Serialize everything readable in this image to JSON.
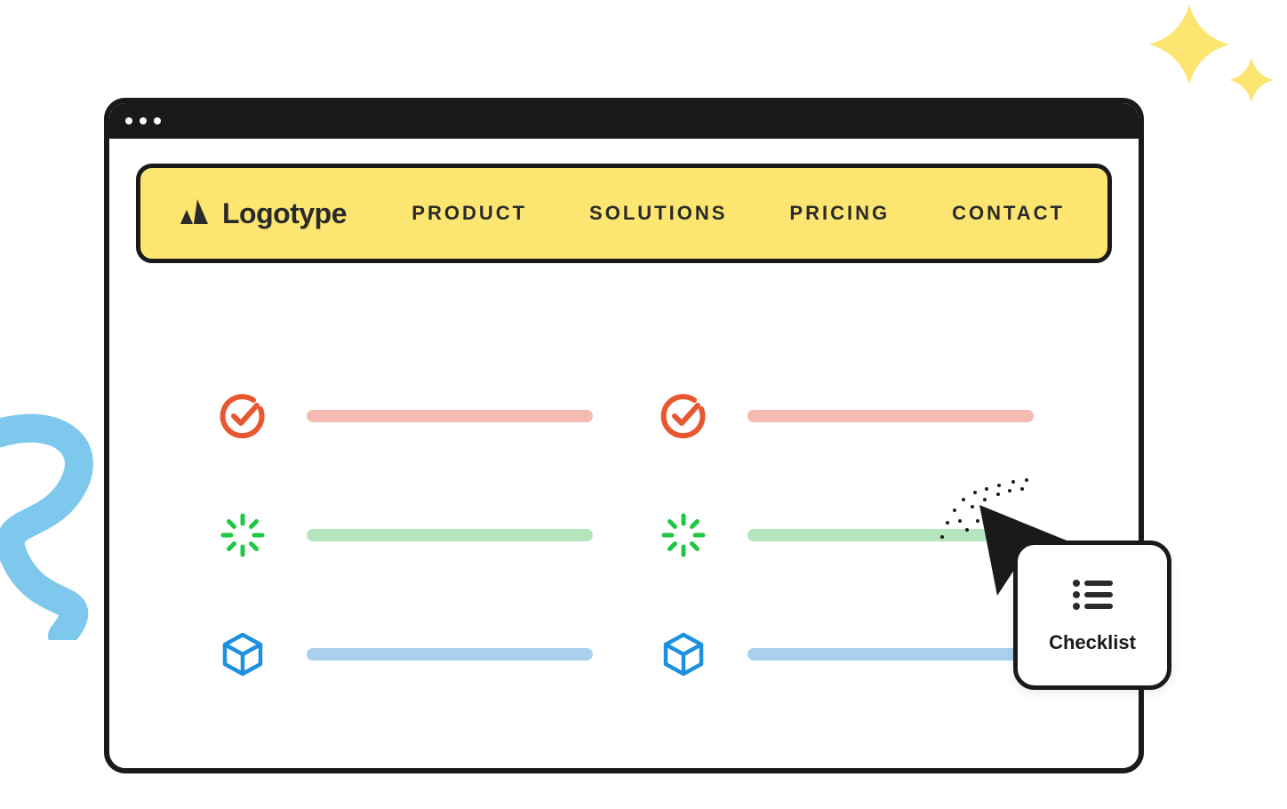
{
  "navbar": {
    "logo_text": "Logotype",
    "links": [
      "PRODUCT",
      "SOLUTIONS",
      "PRICING",
      "CONTACT"
    ]
  },
  "grid": {
    "rows": [
      {
        "icon": "check-circle",
        "bar_color": "red"
      },
      {
        "icon": "check-circle",
        "bar_color": "red"
      },
      {
        "icon": "loading",
        "bar_color": "green"
      },
      {
        "icon": "loading",
        "bar_color": "green"
      },
      {
        "icon": "cube",
        "bar_color": "blue"
      },
      {
        "icon": "cube",
        "bar_color": "blue"
      }
    ]
  },
  "callout": {
    "label": "Checklist"
  },
  "colors": {
    "accent_yellow": "#fce570",
    "icon_red": "#e8572f",
    "icon_green": "#1fc743",
    "icon_blue": "#1d90e0",
    "sparkle": "#fce570",
    "squiggle": "#7ec8ed"
  }
}
